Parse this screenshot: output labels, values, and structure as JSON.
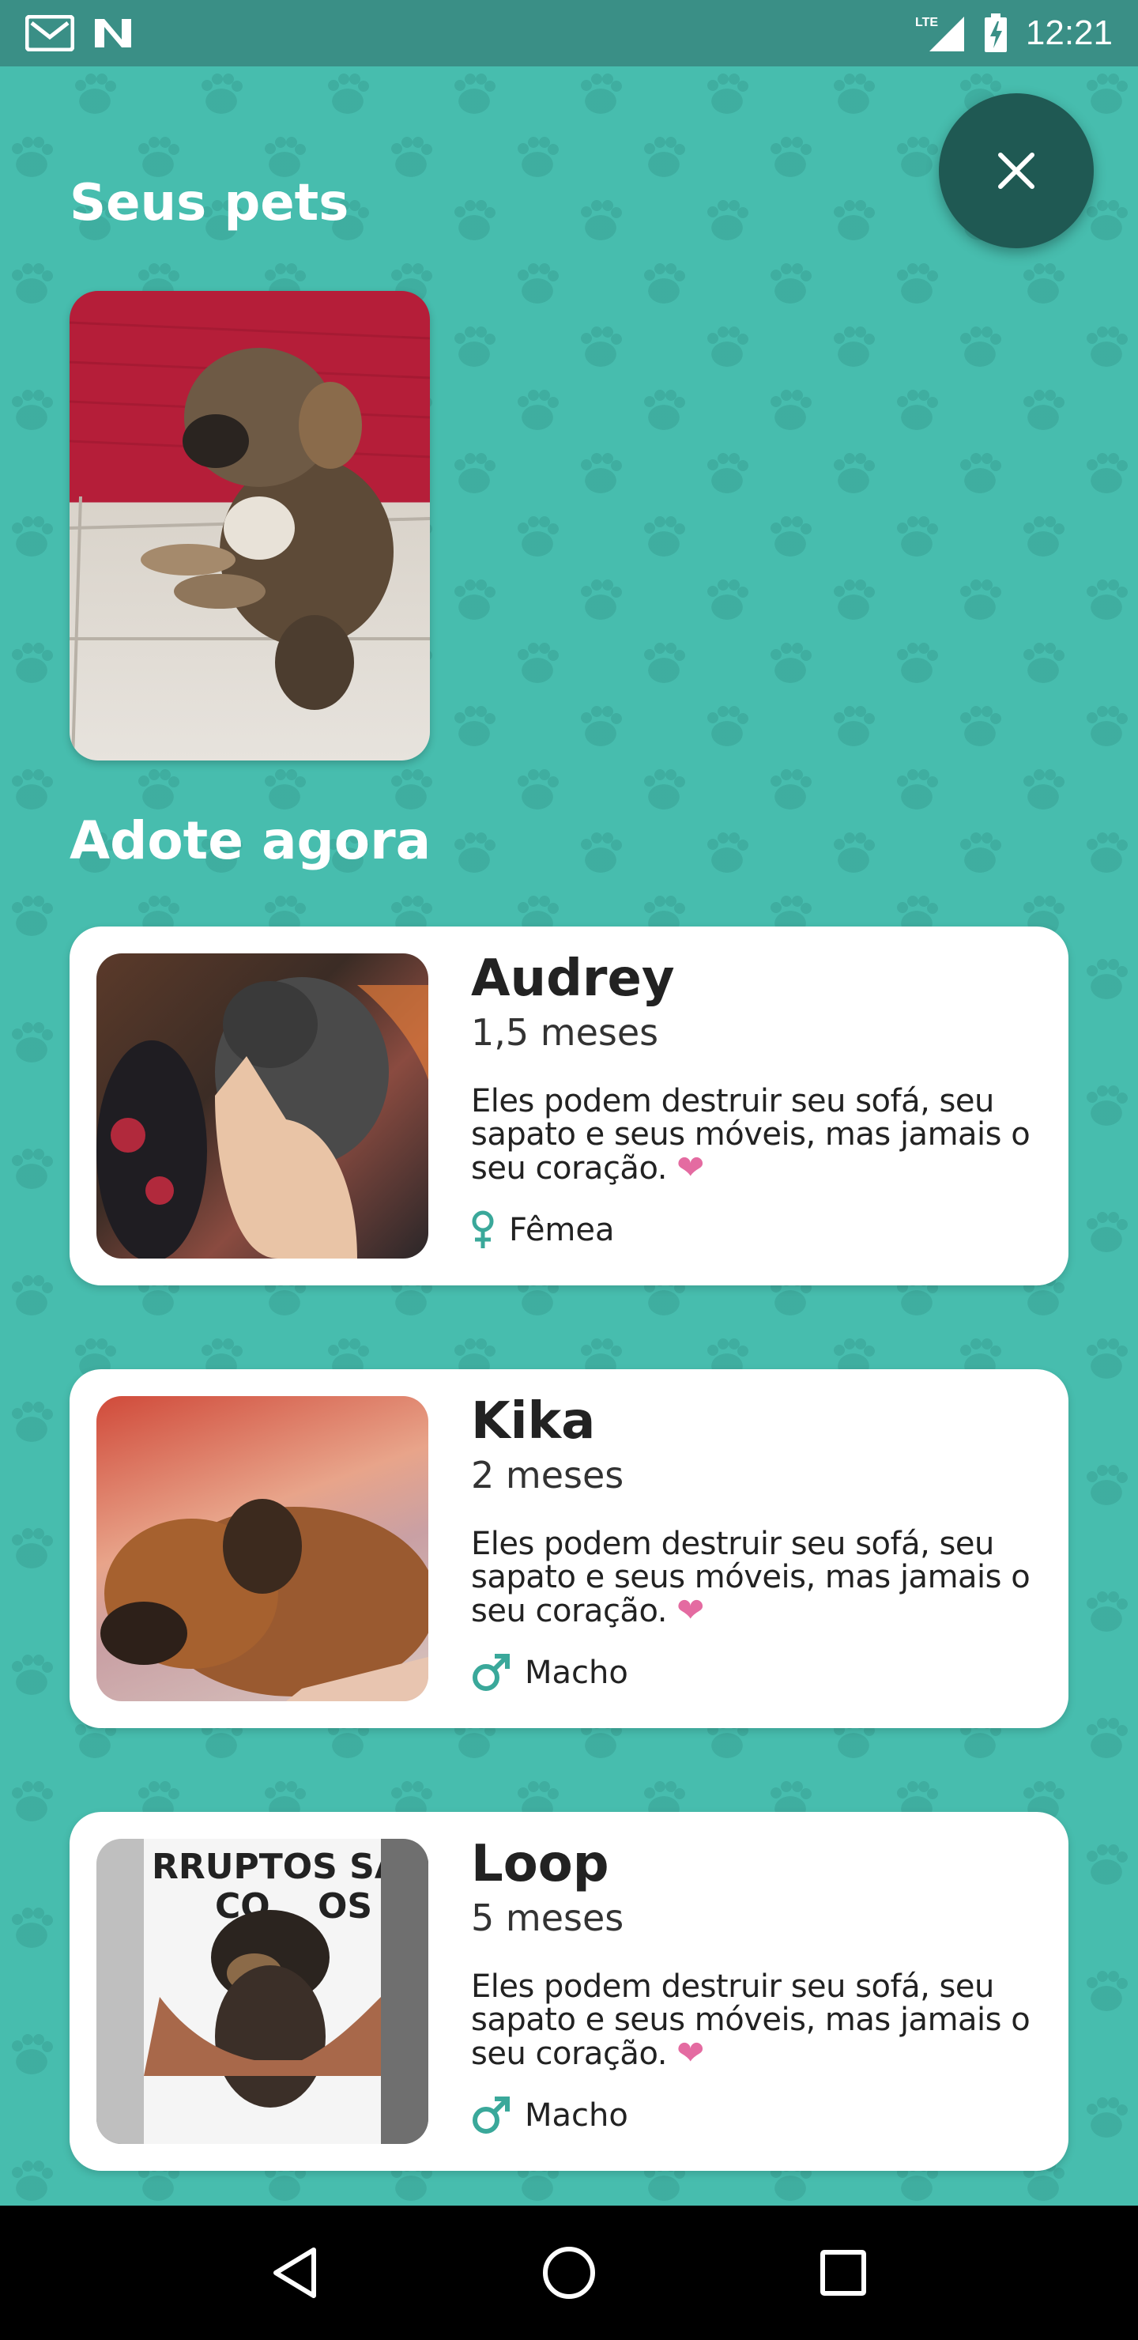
{
  "status_bar": {
    "time": "12:21",
    "network": "LTE",
    "left_icons": [
      "gmail-icon",
      "n-app-icon"
    ],
    "right_icons": [
      "signal-icon",
      "battery-charging-icon"
    ]
  },
  "header": {
    "my_pets_title": "Seus pets",
    "adopt_title": "Adote agora"
  },
  "my_pets": [
    {
      "photo_desc": "puppy-photo"
    }
  ],
  "adoption_list": [
    {
      "name": "Audrey",
      "age": "1,5 meses",
      "description": "Eles podem destruir seu sofá, seu sapato e seus móveis, mas jamais o seu coração.",
      "gender": "Fêmea",
      "gender_icon": "female-icon"
    },
    {
      "name": "Kika",
      "age": "2 meses",
      "description": "Eles podem destruir seu sofá, seu sapato e seus móveis, mas jamais o seu coração.",
      "gender": "Macho",
      "gender_icon": "male-icon"
    },
    {
      "name": "Loop",
      "age": "5 meses",
      "description": "Eles podem destruir seu sofá, seu sapato e seus móveis, mas jamais o seu coração.",
      "gender": "Macho",
      "gender_icon": "male-icon"
    }
  ],
  "colors": {
    "background": "#47bdae",
    "accent": "#3aa89a",
    "fab": "#1f5953",
    "heart": "#e46ba1"
  },
  "nav": {
    "buttons": [
      "back-icon",
      "home-icon",
      "recents-icon"
    ]
  }
}
